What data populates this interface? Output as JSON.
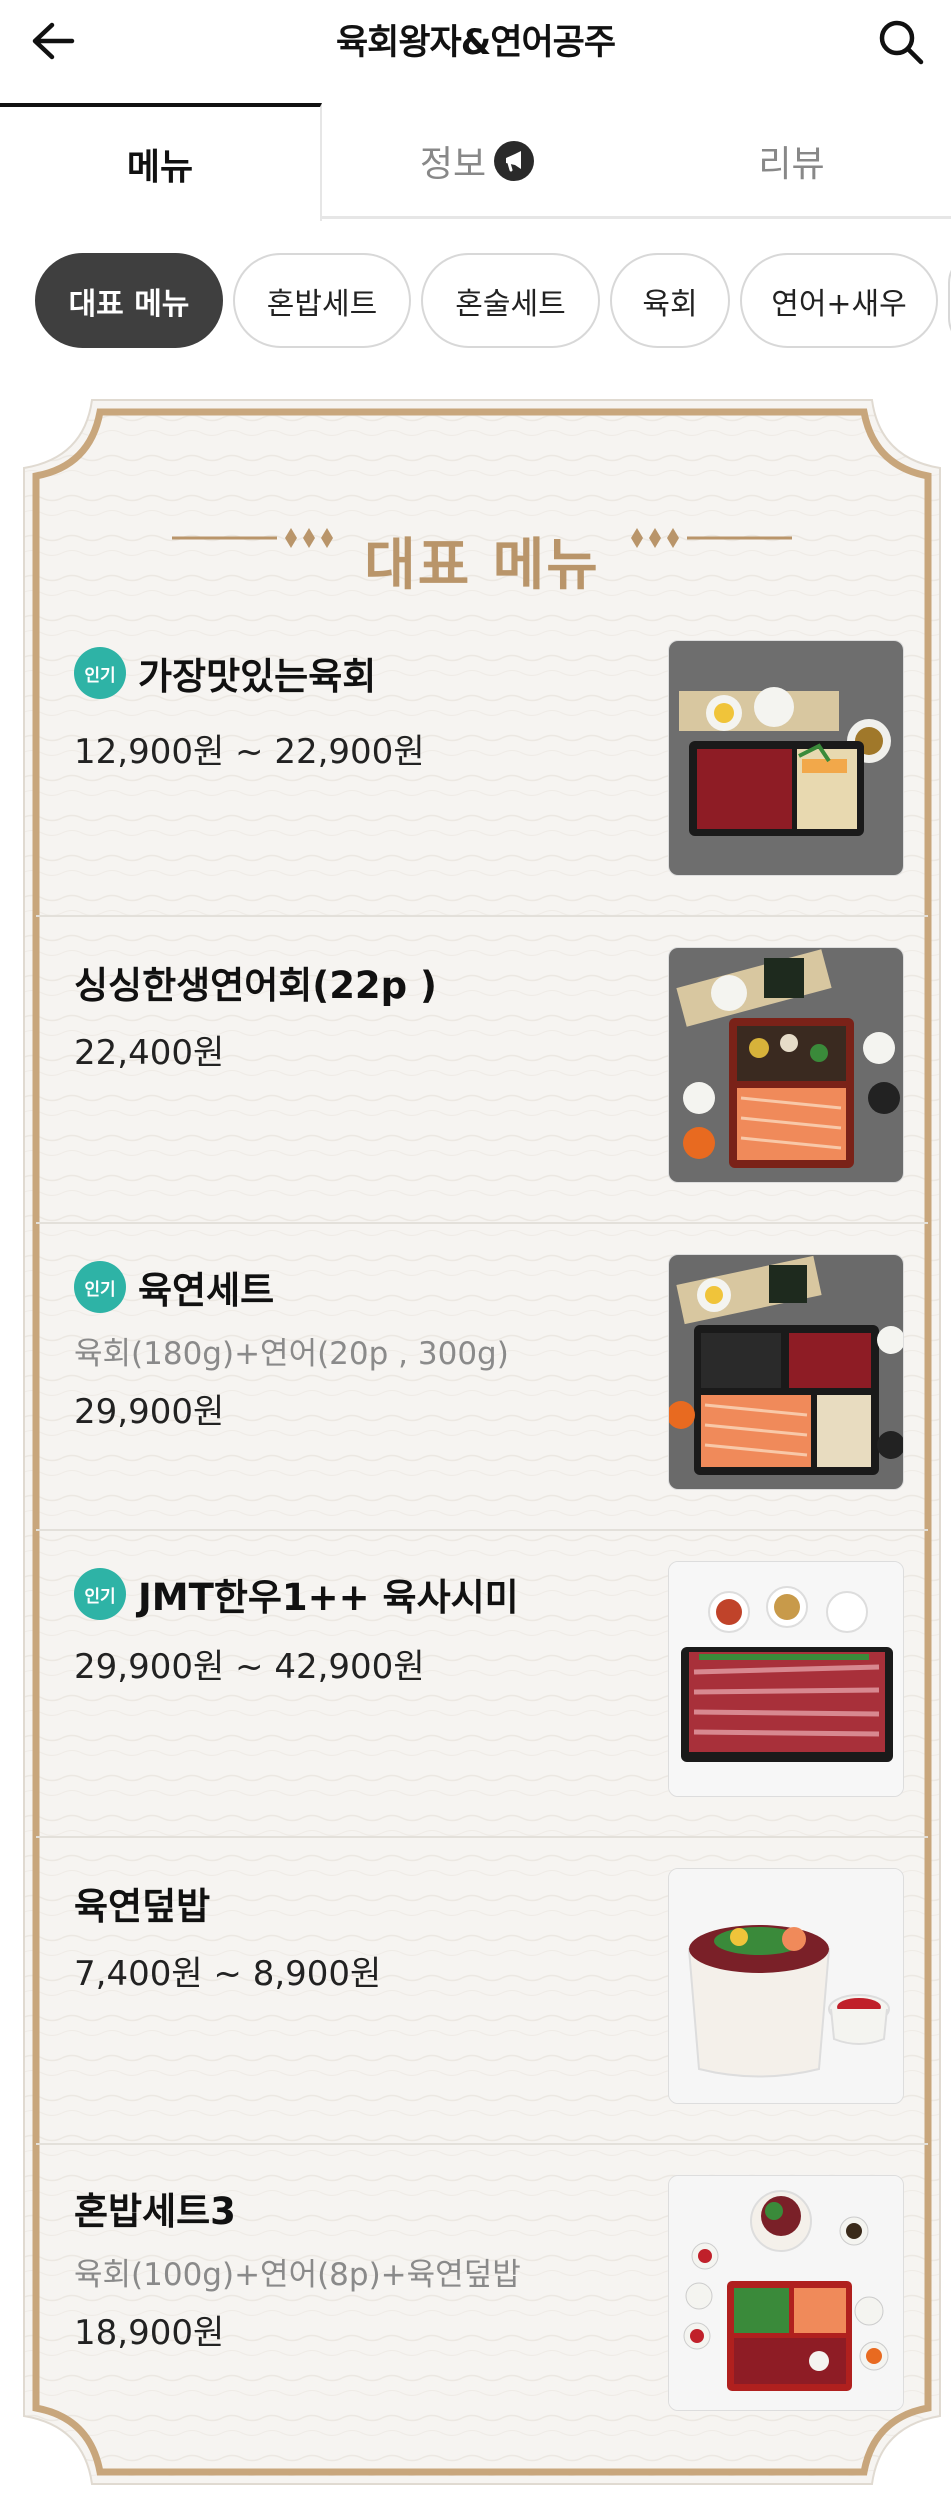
{
  "header": {
    "title": "육회왕자&연어공주"
  },
  "tabs": [
    {
      "label": "메뉴",
      "active": true
    },
    {
      "label": "정보",
      "active": false
    },
    {
      "label": "리뷰",
      "active": false
    }
  ],
  "chips": [
    {
      "label": "대표 메뉴",
      "active": true
    },
    {
      "label": "혼밥세트",
      "active": false
    },
    {
      "label": "혼술세트",
      "active": false
    },
    {
      "label": "육회",
      "active": false
    },
    {
      "label": "연어+새우",
      "active": false
    }
  ],
  "section": {
    "title": "대표 메뉴"
  },
  "menu_items": [
    {
      "badge": "인기",
      "name": "가장맛있는육회",
      "desc": "",
      "price": "12,900원 ~ 22,900원"
    },
    {
      "badge": "",
      "name": "싱싱한생연어회(22p )",
      "desc": "",
      "price": "22,400원"
    },
    {
      "badge": "인기",
      "name": "육연세트",
      "desc": "육회(180g)+연어(20p , 300g)",
      "price": "29,900원"
    },
    {
      "badge": "인기",
      "name": "JMT한우1++ 육사시미",
      "desc": "",
      "price": "29,900원 ~ 42,900원"
    },
    {
      "badge": "",
      "name": "육연덮밥",
      "desc": "",
      "price": "7,400원 ~ 8,900원"
    },
    {
      "badge": "",
      "name": "혼밥세트3",
      "desc": "육회(100g)+연어(8p)+육연덮밥",
      "price": "18,900원"
    }
  ],
  "colors": {
    "accent_gold": "#b9956a",
    "badge_teal": "#2eb3a6",
    "chip_active": "#3f3f3f"
  }
}
